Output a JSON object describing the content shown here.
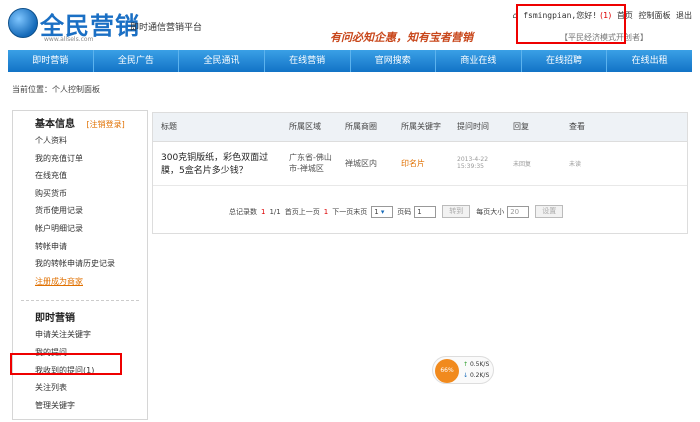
{
  "logo": {
    "brand": "全民营销",
    "slogan": "即时通信营销平台",
    "url": "www.allsels.com"
  },
  "topbar": {
    "user": "fsmingpian,您好!",
    "count": "(1)",
    "home": "首页",
    "control": "控制面板",
    "exit": "退出"
  },
  "motto": {
    "text": "有问必知企惠，知有宝者营销",
    "sub": "【平民经济模式开创者】"
  },
  "nav": [
    "即时营销",
    "全民广告",
    "全民通讯",
    "在线营销",
    "官网搜索",
    "商业在线",
    "在线招聘",
    "在线出租"
  ],
  "breadcrumb": "当前位置：个人控制面板",
  "sidebar": {
    "basic_title": "基本信息",
    "logout": "[注销登录]",
    "basic_items": [
      "个人资料",
      "我的充值订单",
      "在线充值",
      "购买货币",
      "货币使用记录",
      "帐户明细记录",
      "转帐申请",
      "我的转帐申请历史记录"
    ],
    "basic_link": "注册成为商家",
    "marketing_title": "即时营销",
    "marketing_items": [
      "申请关注关键字",
      "我的提问",
      "我收到的提问(1)",
      "关注列表",
      "管理关键字"
    ]
  },
  "table": {
    "headers": [
      "标题",
      "所属区域",
      "所属商圈",
      "所属关键字",
      "提问时间",
      "回复",
      "查看"
    ],
    "rows": [
      {
        "title": "300克铜版纸，彩色双面过膜，5盒名片多少钱？",
        "region": "广东省-佛山市-禅城区",
        "circle": "禅城区内",
        "keyword": "印名片",
        "time": "2013-4-22 15:39:35",
        "reply": "未回复",
        "view": "未读"
      }
    ]
  },
  "pager": {
    "total_label": "总记录数",
    "total": "1",
    "pages": "1/1",
    "first": "首页",
    "prev": "上一页",
    "current": "1",
    "next": "下一页",
    "last": "末页",
    "select": "1",
    "page_label": "页码",
    "page_value": "1",
    "go": "转到",
    "size_label": "每页大小",
    "size_value": "20",
    "set": "设置"
  },
  "speed": {
    "percent": "66%",
    "up": "0.5K/S",
    "down": "0.2K/S"
  }
}
